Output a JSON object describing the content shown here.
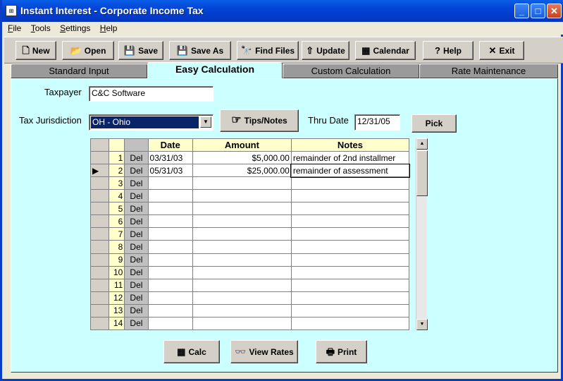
{
  "window": {
    "title": "Instant Interest - Corporate Income Tax",
    "icon_text": "⊞",
    "min": "_",
    "max": "□",
    "close": "✕"
  },
  "menu": [
    {
      "key": "F",
      "rest": "ile"
    },
    {
      "key": "T",
      "rest": "ools"
    },
    {
      "key": "S",
      "rest": "ettings"
    },
    {
      "key": "H",
      "rest": "elp"
    }
  ],
  "toolbar": {
    "new": "New",
    "open": "Open",
    "save": "Save",
    "save_as": "Save As",
    "find_files": "Find Files",
    "update": "Update",
    "calendar": "Calendar",
    "help": "Help",
    "exit": "Exit"
  },
  "tabs": [
    "Standard Input",
    "Easy Calculation",
    "Custom Calculation",
    "Rate Maintenance"
  ],
  "form": {
    "taxpayer_label": "Taxpayer",
    "taxpayer_value": "C&C Software",
    "jurisdiction_label": "Tax Jurisdiction",
    "jurisdiction_value": "OH - Ohio",
    "tips_label": "Tips/Notes",
    "thru_label": "Thru Date",
    "thru_value": "12/31/05",
    "pick_label": "Pick"
  },
  "grid": {
    "headers": [
      "Date",
      "Amount",
      "Notes"
    ],
    "del_label": "Del",
    "current_row_marker": "▶",
    "rows": [
      {
        "n": "1",
        "date": "03/31/03",
        "amount": "$5,000.00",
        "notes": "remainder of 2nd installmer"
      },
      {
        "n": "2",
        "date": "05/31/03",
        "amount": "$25,000.00",
        "notes": "remainder of assessment"
      },
      {
        "n": "3",
        "date": "",
        "amount": "",
        "notes": ""
      },
      {
        "n": "4",
        "date": "",
        "amount": "",
        "notes": ""
      },
      {
        "n": "5",
        "date": "",
        "amount": "",
        "notes": ""
      },
      {
        "n": "6",
        "date": "",
        "amount": "",
        "notes": ""
      },
      {
        "n": "7",
        "date": "",
        "amount": "",
        "notes": ""
      },
      {
        "n": "8",
        "date": "",
        "amount": "",
        "notes": ""
      },
      {
        "n": "9",
        "date": "",
        "amount": "",
        "notes": ""
      },
      {
        "n": "10",
        "date": "",
        "amount": "",
        "notes": ""
      },
      {
        "n": "11",
        "date": "",
        "amount": "",
        "notes": ""
      },
      {
        "n": "12",
        "date": "",
        "amount": "",
        "notes": ""
      },
      {
        "n": "13",
        "date": "",
        "amount": "",
        "notes": ""
      },
      {
        "n": "14",
        "date": "",
        "amount": "",
        "notes": ""
      }
    ]
  },
  "actions": {
    "calc": "Calc",
    "view_rates": "View Rates",
    "print": "Print"
  },
  "icons": {
    "new": "🗋",
    "open": "📂",
    "save": "💾",
    "save_as": "💾",
    "find": "🔭",
    "update": "⇧",
    "calendar": "▦",
    "help": "?",
    "exit": "✕",
    "tips": "☞",
    "calc": "▦",
    "view_rates": "👓",
    "print": "🖶",
    "scroll_up": "▲",
    "scroll_down": "▼",
    "dropdown": "▼"
  }
}
